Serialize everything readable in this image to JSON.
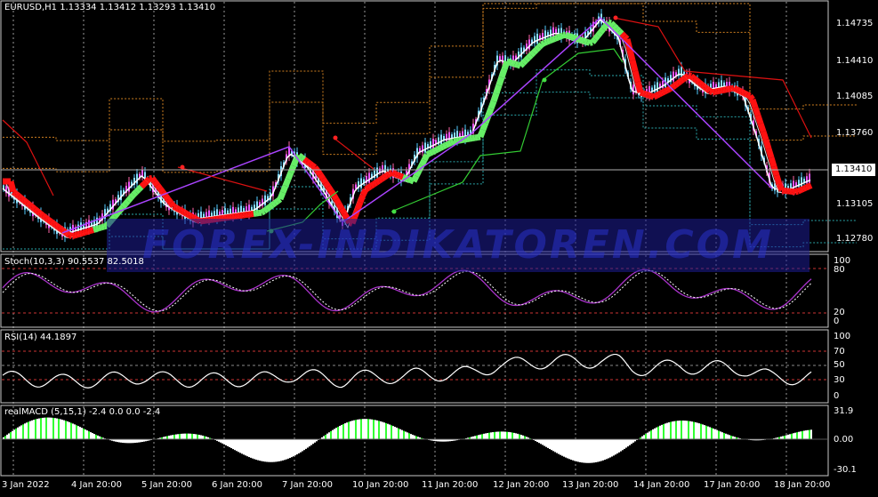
{
  "main": {
    "symbol_header": "EURUSD,H1  1.13334 1.13412 1.13293 1.13410",
    "price_levels": [
      "1.14735",
      "1.14410",
      "1.14085",
      "1.13760",
      "1.13105",
      "1.12780"
    ],
    "current_price": "1.13410"
  },
  "stoch": {
    "header": "Stoch(10,3,3) 90.5537 82.5018",
    "levels": [
      "100",
      "80",
      "20",
      "0"
    ]
  },
  "rsi": {
    "header": "RSI(14) 44.1897",
    "levels": [
      "100",
      "70",
      "50",
      "30",
      "0"
    ]
  },
  "macd": {
    "header": "realMACD (5,15,1) -2.4 0.0 0.0 -2.4",
    "levels": [
      "31.9",
      "0.00",
      "-30.1"
    ]
  },
  "time_axis": [
    "3 Jan 2022",
    "4 Jan 20:00",
    "5 Jan 20:00",
    "6 Jan 20:00",
    "7 Jan 20:00",
    "10 Jan 20:00",
    "11 Jan 20:00",
    "12 Jan 20:00",
    "13 Jan 20:00",
    "14 Jan 20:00",
    "17 Jan 20:00",
    "18 Jan 20:00"
  ],
  "watermark": "FOREX-INDIKATOREN.COM",
  "colors": {
    "bull": "#66ee66",
    "bear": "#ff1111",
    "stoch": "#aa33cc",
    "zigzag": "#aa44ff",
    "grid": "#cccccc"
  }
}
